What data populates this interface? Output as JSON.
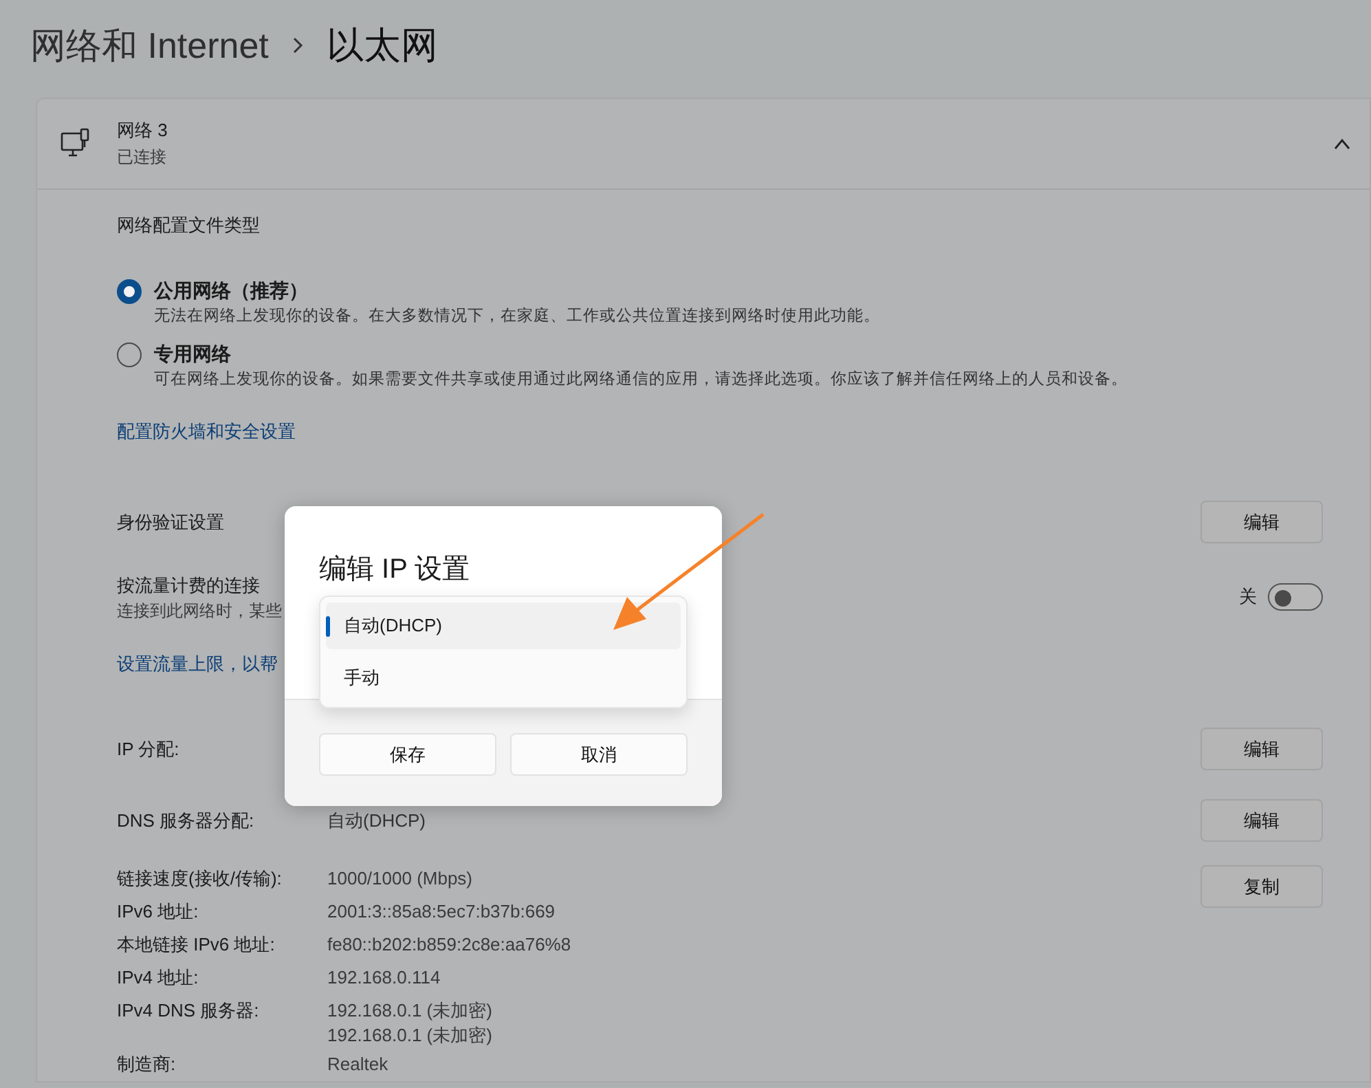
{
  "header": {
    "parent": "网络和 Internet",
    "current": "以太网"
  },
  "connection": {
    "name": "网络 3",
    "status": "已连接",
    "expanded": true
  },
  "profile": {
    "heading": "网络配置文件类型",
    "link": "配置防火墙和安全设置",
    "options": [
      {
        "label": "公用网络（推荐）",
        "description": "无法在网络上发现你的设备。在大多数情况下，在家庭、工作或公共位置连接到网络时使用此功能。",
        "selected": true
      },
      {
        "label": "专用网络",
        "description": "可在网络上发现你的设备。如果需要文件共享或使用通过此网络通信的应用，请选择此选项。你应该了解并信任网络上的人员和设备。",
        "selected": false
      }
    ]
  },
  "settings": [
    {
      "kind": "button",
      "label": "身份验证设置",
      "button": "编辑"
    },
    {
      "kind": "toggle",
      "label": "按流量计费的连接",
      "description": "连接到此网络时，某些",
      "state_label": "关",
      "on": false,
      "link": "设置流量上限，以帮"
    },
    {
      "kind": "button",
      "label": "IP 分配:",
      "button": "编辑"
    },
    {
      "kind": "value",
      "label": "DNS 服务器分配:",
      "value": "自动(DHCP)",
      "button": "编辑"
    }
  ],
  "properties": {
    "button": "复制",
    "rows": [
      {
        "label": "链接速度(接收/传输):",
        "values": [
          "1000/1000 (Mbps)"
        ]
      },
      {
        "label": "IPv6 地址:",
        "values": [
          "2001:3::85a8:5ec7:b37b:669"
        ]
      },
      {
        "label": "本地链接 IPv6 地址:",
        "values": [
          "fe80::b202:b859:2c8e:aa76%8"
        ]
      },
      {
        "label": "IPv4 地址:",
        "values": [
          "192.168.0.114"
        ]
      },
      {
        "label": "IPv4 DNS 服务器:",
        "values": [
          "192.168.0.1 (未加密)",
          "192.168.0.1 (未加密)"
        ]
      },
      {
        "label": "制造商:",
        "values": [
          "Realtek"
        ]
      }
    ]
  },
  "dialog": {
    "title": "编辑 IP 设置",
    "options": [
      {
        "label": "自动(DHCP)",
        "selected": true
      },
      {
        "label": "手动",
        "selected": false
      }
    ],
    "buttons": [
      "保存",
      "取消"
    ]
  }
}
